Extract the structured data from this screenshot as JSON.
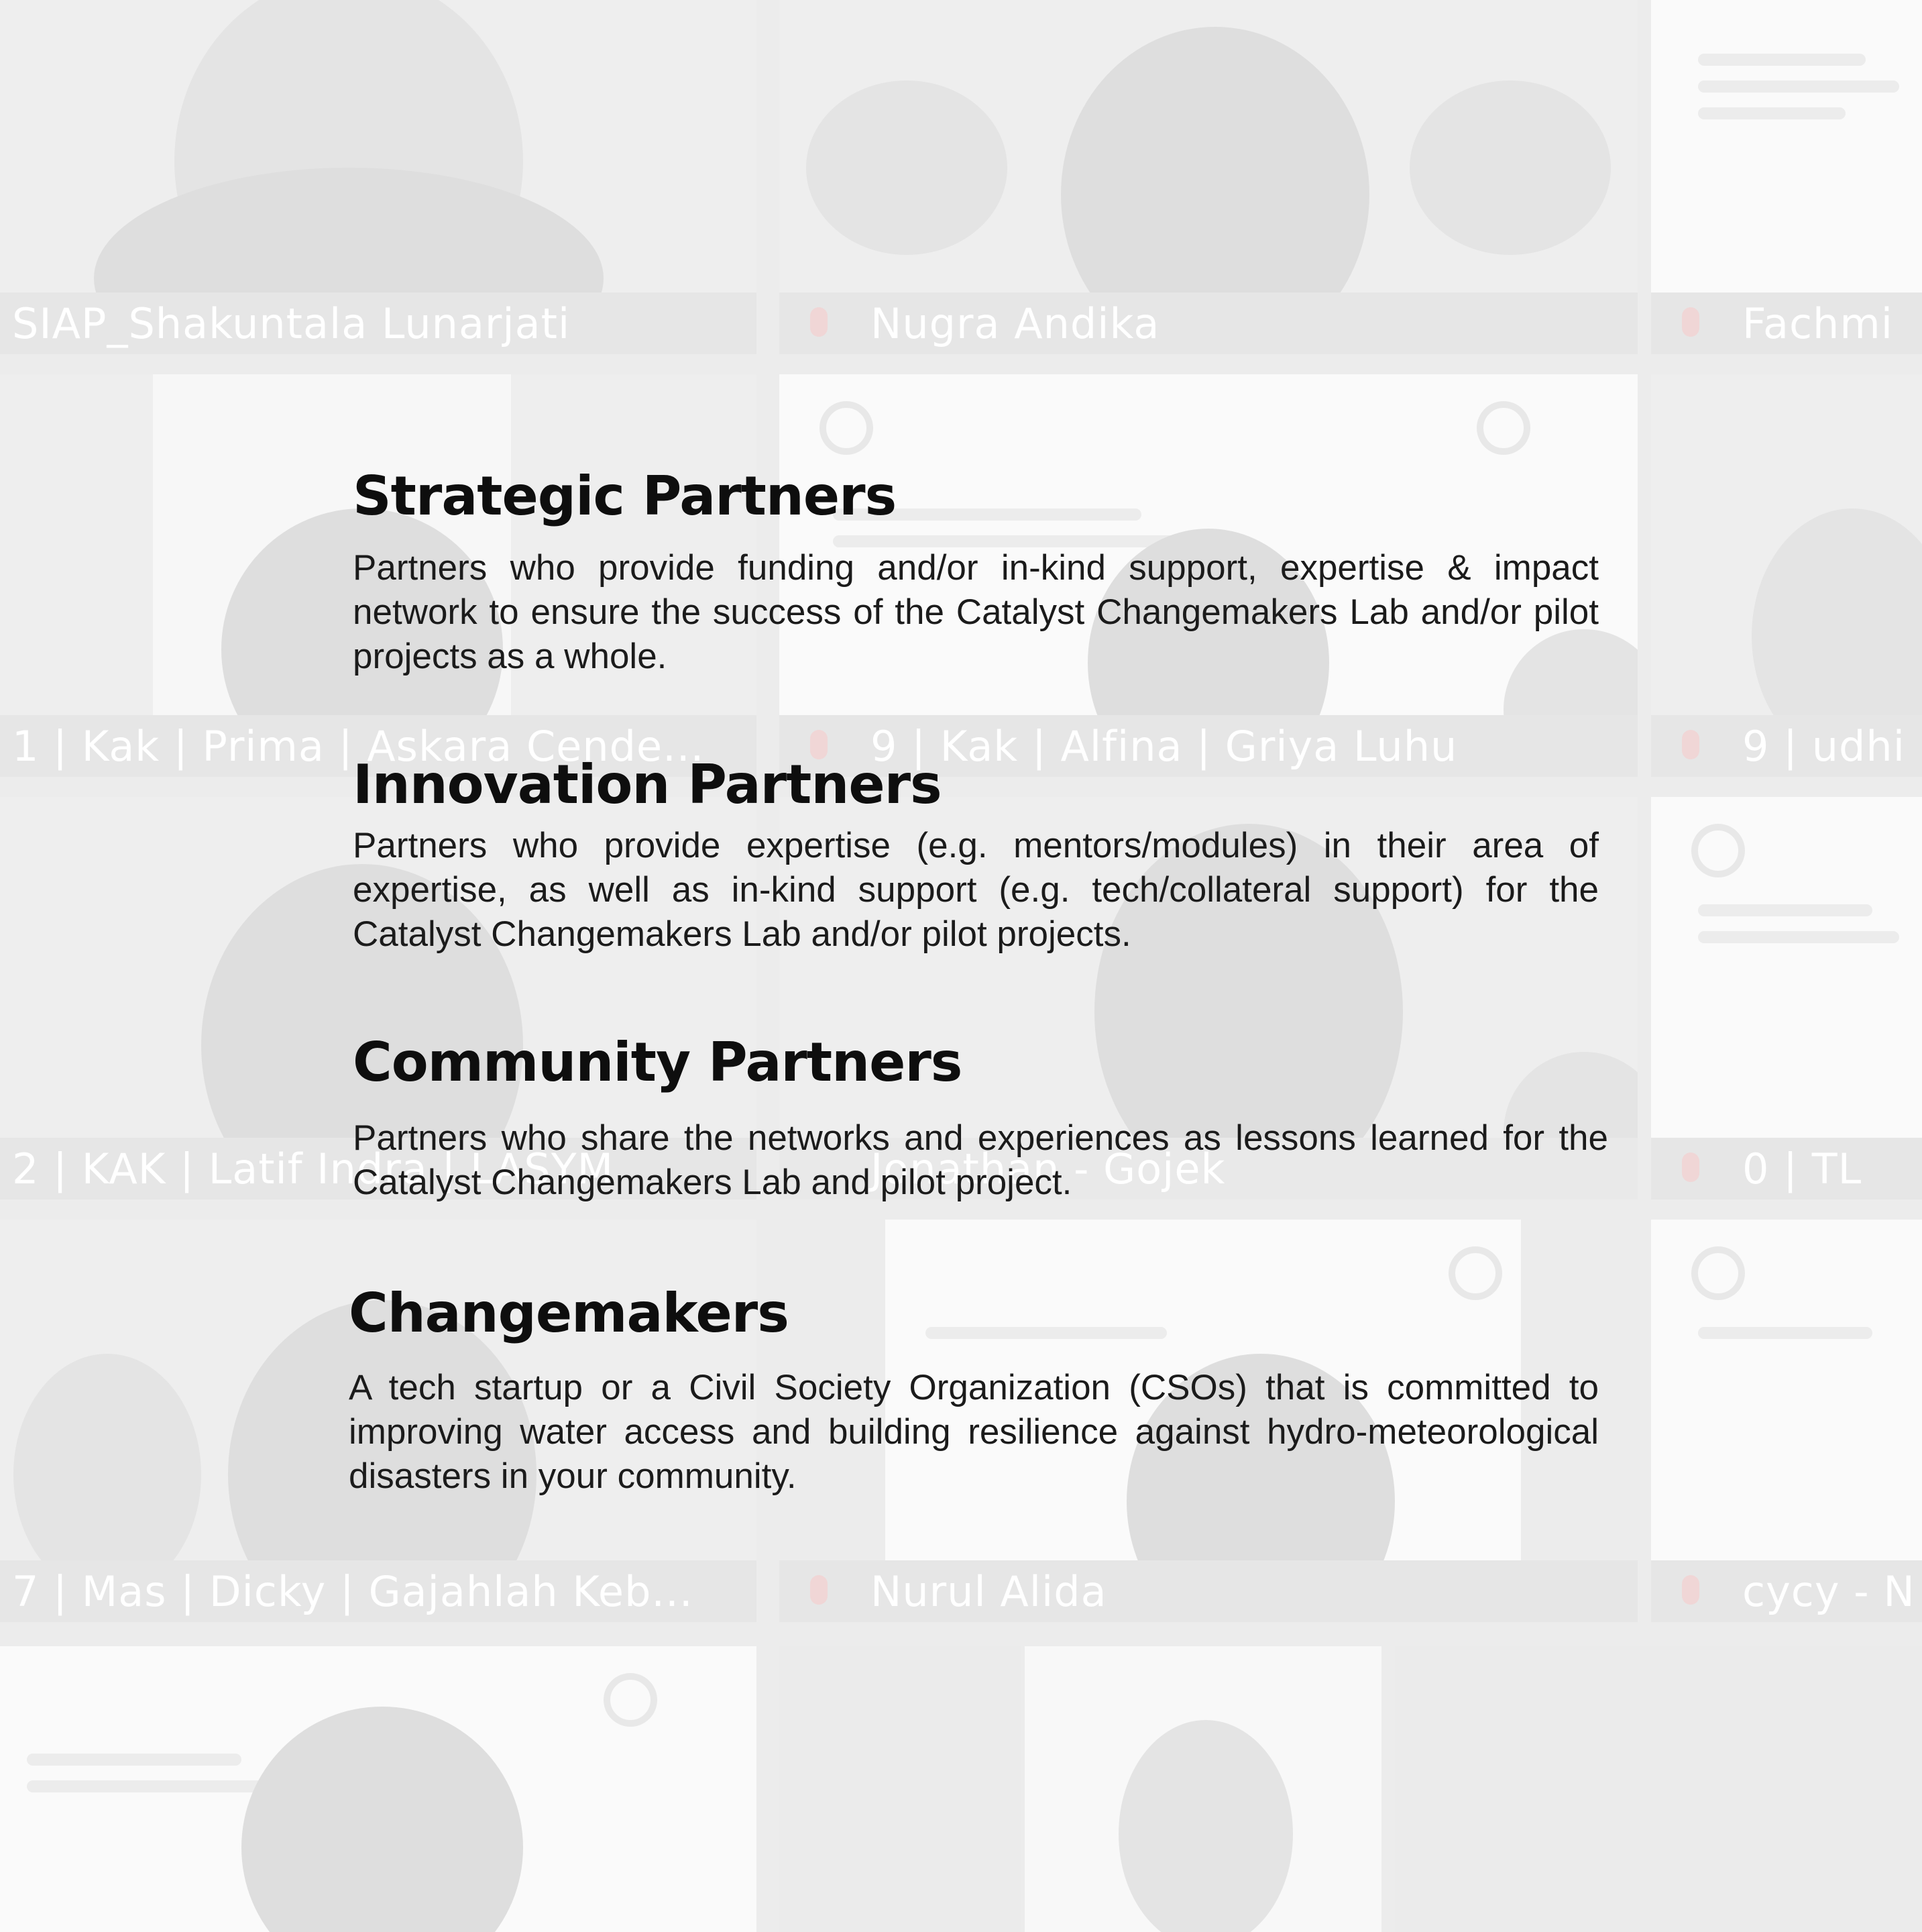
{
  "participants": [
    "SIAP_Shakuntala Lunarjati",
    "Nugra Andika",
    "Fachmi",
    "1 | Kak | Prima | Askara Cende...",
    "9 | Kak | Alfina | Griya Luhu",
    "9 | udhi",
    "2 | KAK | Latif Indra | LASYM",
    "Jonathan - Gojek",
    "0 | TL",
    "7 | Mas | Dicky | Gajahlah Keb...",
    "Nurul Alida",
    "cycy - N"
  ],
  "sections": [
    {
      "title": "Strategic Partners",
      "description": "Partners who provide funding and/or in-kind support, expertise & impact network to ensure the success of the Catalyst Changemakers Lab and/or pilot projects as a whole."
    },
    {
      "title": "Innovation Partners",
      "description": "Partners who provide expertise (e.g. mentors/modules) in their area of expertise, as well as in-kind support (e.g. tech/collateral support) for the Catalyst Changemakers Lab and/or pilot projects."
    },
    {
      "title": "Community Partners",
      "description": "Partners who share the networks and experiences as lessons learned for the Catalyst Changemakers Lab and pilot project."
    },
    {
      "title": "Changemakers",
      "description": "A tech startup or a Civil Society Organization (CSOs) that is committed to improving water access and building resilience against hydro-meteorological disasters in your community."
    }
  ]
}
